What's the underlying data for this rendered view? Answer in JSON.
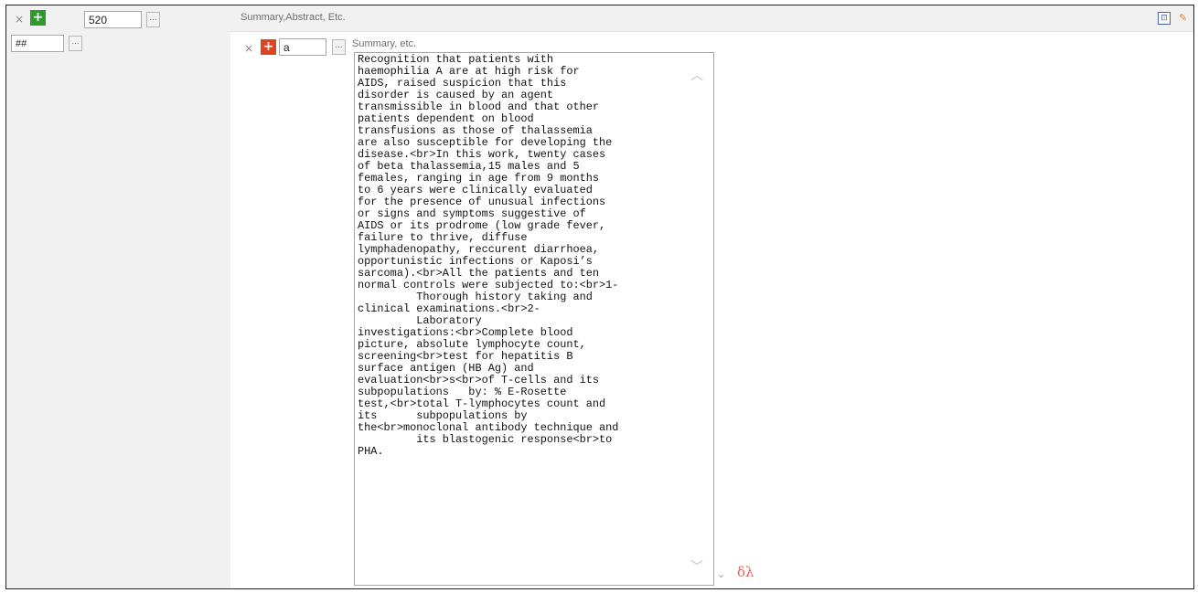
{
  "row1": {
    "remove_icon": "×",
    "add_icon": "+",
    "tag_value": "520",
    "browse_label": "...",
    "field_label": "Summary,Abstract, Etc."
  },
  "row2": {
    "indicator_value": "##",
    "browse_label": "..."
  },
  "subfield": {
    "remove_icon": "×",
    "add_icon": "+",
    "code_value": "a",
    "browse_label": "...",
    "label": "Summary, etc.",
    "text": "Recognition that patients with\nhaemophilia A are at high risk for\nAIDS, raised suspicion that this\ndisorder is caused by an agent\ntransmissible in blood and that other\npatients dependent on blood\ntransfusions as those of thalassemia\nare also susceptible for developing the\ndisease.<br>In this work, twenty cases\nof beta thalassemia,15 males and 5\nfemales, ranging in age from 9 months\nto 6 years were clinically evaluated\nfor the presence of unusual infections\nor signs and symptoms suggestive of\nAIDS or its prodrome (low grade fever,\nfailure to thrive, diffuse\nlymphadenopathy, reccurent diarrhoea,\nopportunistic infections or Kaposi’s\nsarcoma).<br>All the patients and ten\nnormal controls were subjected to:<br>1-\n         Thorough history taking and\nclinical examinations.<br>2-\n         Laboratory\ninvestigations:<br>Complete blood\npicture, absolute lymphocyte count,\nscreening<br>test for hepatitis B\nsurface antigen (HB Ag) and\nevaluation<br>s<br>of T-cells and its\nsubpopulations   by: % E-Rosette\ntest,<br>total T-lymphocytes count and\nits      subpopulations by\nthe<br>monoclonal antibody technique and\n         its blastogenic response<br>to\nPHA.",
    "expand_icon": "⌄",
    "greek_label": "δλ"
  },
  "icons": {
    "book": "book-icon",
    "orange": "tool-icon"
  },
  "colors": {
    "add_green": "#2e9a2e",
    "add_red": "#e0431f",
    "greek": "#e06060"
  }
}
